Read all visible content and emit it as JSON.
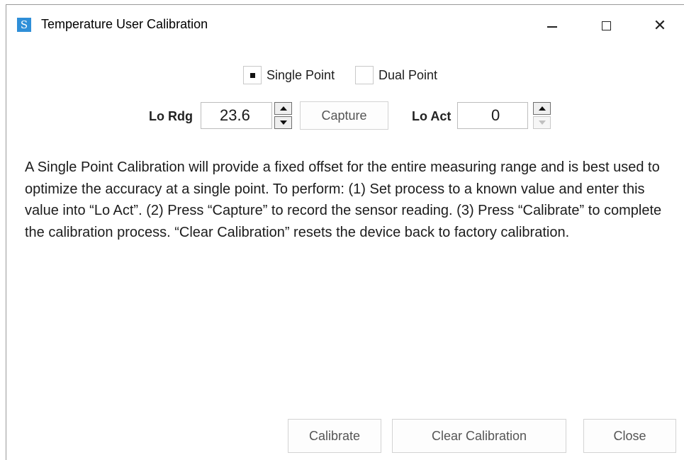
{
  "window": {
    "title": "Temperature User Calibration",
    "app_icon_glyph": "S",
    "app_icon": "app-logo-icon",
    "controls": {
      "minimize": "minimize-icon",
      "maximize": "maximize-icon",
      "close_glyph": "✕"
    }
  },
  "mode": {
    "single_label": "Single Point",
    "dual_label": "Dual Point",
    "selected": "Single Point"
  },
  "lo_rdg": {
    "label": "Lo Rdg",
    "value": "23.6"
  },
  "capture_label": "Capture",
  "lo_act": {
    "label": "Lo Act",
    "value": "0"
  },
  "description": "A Single Point Calibration will provide a fixed offset for the entire measuring range and is best used to optimize the accuracy at a single point. To perform: (1) Set process to a known value and enter this value into “Lo Act”. (2) Press “Capture” to record the sensor reading. (3) Press “Calibrate” to complete the calibration process. “Clear Calibration” resets the device back to factory calibration.",
  "buttons": {
    "calibrate": "Calibrate",
    "clear_calibration": "Clear Calibration",
    "close": "Close"
  },
  "colors": {
    "app_icon_bg": "#2f8fd8"
  }
}
